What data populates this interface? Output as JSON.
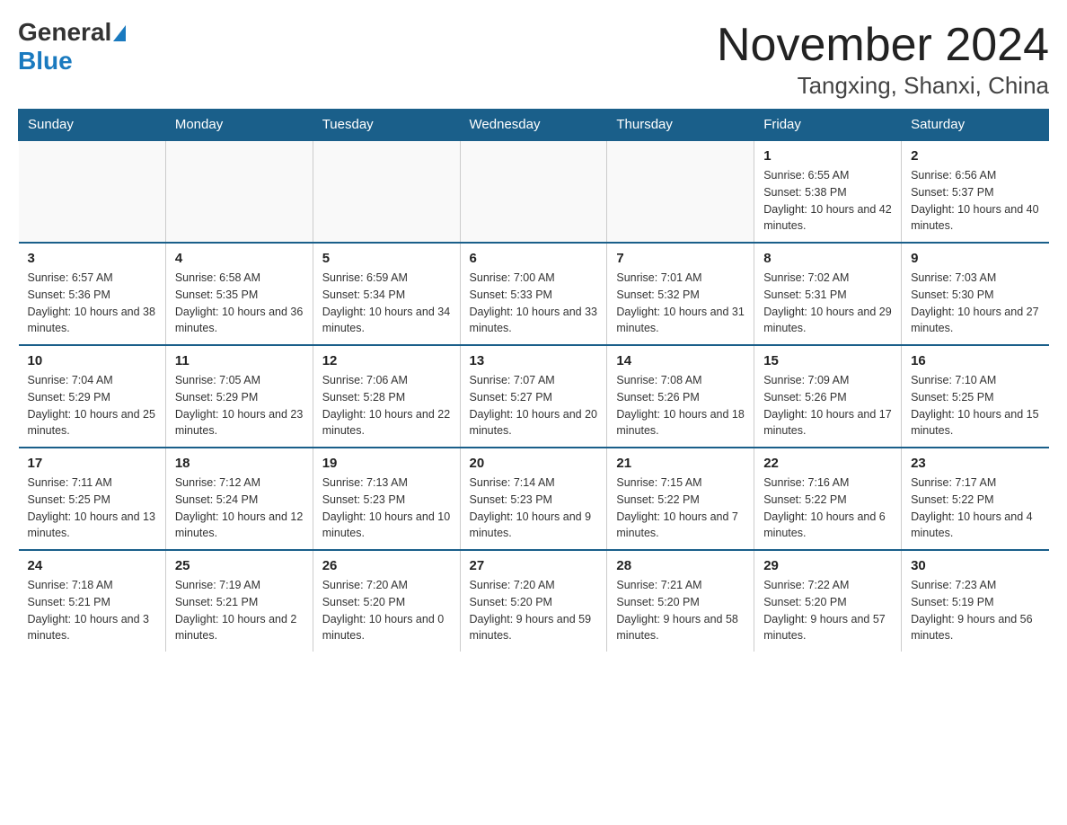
{
  "header": {
    "logo_general": "General",
    "logo_blue": "Blue",
    "title": "November 2024",
    "subtitle": "Tangxing, Shanxi, China"
  },
  "calendar": {
    "days_of_week": [
      "Sunday",
      "Monday",
      "Tuesday",
      "Wednesday",
      "Thursday",
      "Friday",
      "Saturday"
    ],
    "weeks": [
      [
        {
          "day": "",
          "info": ""
        },
        {
          "day": "",
          "info": ""
        },
        {
          "day": "",
          "info": ""
        },
        {
          "day": "",
          "info": ""
        },
        {
          "day": "",
          "info": ""
        },
        {
          "day": "1",
          "info": "Sunrise: 6:55 AM\nSunset: 5:38 PM\nDaylight: 10 hours and 42 minutes."
        },
        {
          "day": "2",
          "info": "Sunrise: 6:56 AM\nSunset: 5:37 PM\nDaylight: 10 hours and 40 minutes."
        }
      ],
      [
        {
          "day": "3",
          "info": "Sunrise: 6:57 AM\nSunset: 5:36 PM\nDaylight: 10 hours and 38 minutes."
        },
        {
          "day": "4",
          "info": "Sunrise: 6:58 AM\nSunset: 5:35 PM\nDaylight: 10 hours and 36 minutes."
        },
        {
          "day": "5",
          "info": "Sunrise: 6:59 AM\nSunset: 5:34 PM\nDaylight: 10 hours and 34 minutes."
        },
        {
          "day": "6",
          "info": "Sunrise: 7:00 AM\nSunset: 5:33 PM\nDaylight: 10 hours and 33 minutes."
        },
        {
          "day": "7",
          "info": "Sunrise: 7:01 AM\nSunset: 5:32 PM\nDaylight: 10 hours and 31 minutes."
        },
        {
          "day": "8",
          "info": "Sunrise: 7:02 AM\nSunset: 5:31 PM\nDaylight: 10 hours and 29 minutes."
        },
        {
          "day": "9",
          "info": "Sunrise: 7:03 AM\nSunset: 5:30 PM\nDaylight: 10 hours and 27 minutes."
        }
      ],
      [
        {
          "day": "10",
          "info": "Sunrise: 7:04 AM\nSunset: 5:29 PM\nDaylight: 10 hours and 25 minutes."
        },
        {
          "day": "11",
          "info": "Sunrise: 7:05 AM\nSunset: 5:29 PM\nDaylight: 10 hours and 23 minutes."
        },
        {
          "day": "12",
          "info": "Sunrise: 7:06 AM\nSunset: 5:28 PM\nDaylight: 10 hours and 22 minutes."
        },
        {
          "day": "13",
          "info": "Sunrise: 7:07 AM\nSunset: 5:27 PM\nDaylight: 10 hours and 20 minutes."
        },
        {
          "day": "14",
          "info": "Sunrise: 7:08 AM\nSunset: 5:26 PM\nDaylight: 10 hours and 18 minutes."
        },
        {
          "day": "15",
          "info": "Sunrise: 7:09 AM\nSunset: 5:26 PM\nDaylight: 10 hours and 17 minutes."
        },
        {
          "day": "16",
          "info": "Sunrise: 7:10 AM\nSunset: 5:25 PM\nDaylight: 10 hours and 15 minutes."
        }
      ],
      [
        {
          "day": "17",
          "info": "Sunrise: 7:11 AM\nSunset: 5:25 PM\nDaylight: 10 hours and 13 minutes."
        },
        {
          "day": "18",
          "info": "Sunrise: 7:12 AM\nSunset: 5:24 PM\nDaylight: 10 hours and 12 minutes."
        },
        {
          "day": "19",
          "info": "Sunrise: 7:13 AM\nSunset: 5:23 PM\nDaylight: 10 hours and 10 minutes."
        },
        {
          "day": "20",
          "info": "Sunrise: 7:14 AM\nSunset: 5:23 PM\nDaylight: 10 hours and 9 minutes."
        },
        {
          "day": "21",
          "info": "Sunrise: 7:15 AM\nSunset: 5:22 PM\nDaylight: 10 hours and 7 minutes."
        },
        {
          "day": "22",
          "info": "Sunrise: 7:16 AM\nSunset: 5:22 PM\nDaylight: 10 hours and 6 minutes."
        },
        {
          "day": "23",
          "info": "Sunrise: 7:17 AM\nSunset: 5:22 PM\nDaylight: 10 hours and 4 minutes."
        }
      ],
      [
        {
          "day": "24",
          "info": "Sunrise: 7:18 AM\nSunset: 5:21 PM\nDaylight: 10 hours and 3 minutes."
        },
        {
          "day": "25",
          "info": "Sunrise: 7:19 AM\nSunset: 5:21 PM\nDaylight: 10 hours and 2 minutes."
        },
        {
          "day": "26",
          "info": "Sunrise: 7:20 AM\nSunset: 5:20 PM\nDaylight: 10 hours and 0 minutes."
        },
        {
          "day": "27",
          "info": "Sunrise: 7:20 AM\nSunset: 5:20 PM\nDaylight: 9 hours and 59 minutes."
        },
        {
          "day": "28",
          "info": "Sunrise: 7:21 AM\nSunset: 5:20 PM\nDaylight: 9 hours and 58 minutes."
        },
        {
          "day": "29",
          "info": "Sunrise: 7:22 AM\nSunset: 5:20 PM\nDaylight: 9 hours and 57 minutes."
        },
        {
          "day": "30",
          "info": "Sunrise: 7:23 AM\nSunset: 5:19 PM\nDaylight: 9 hours and 56 minutes."
        }
      ]
    ]
  }
}
